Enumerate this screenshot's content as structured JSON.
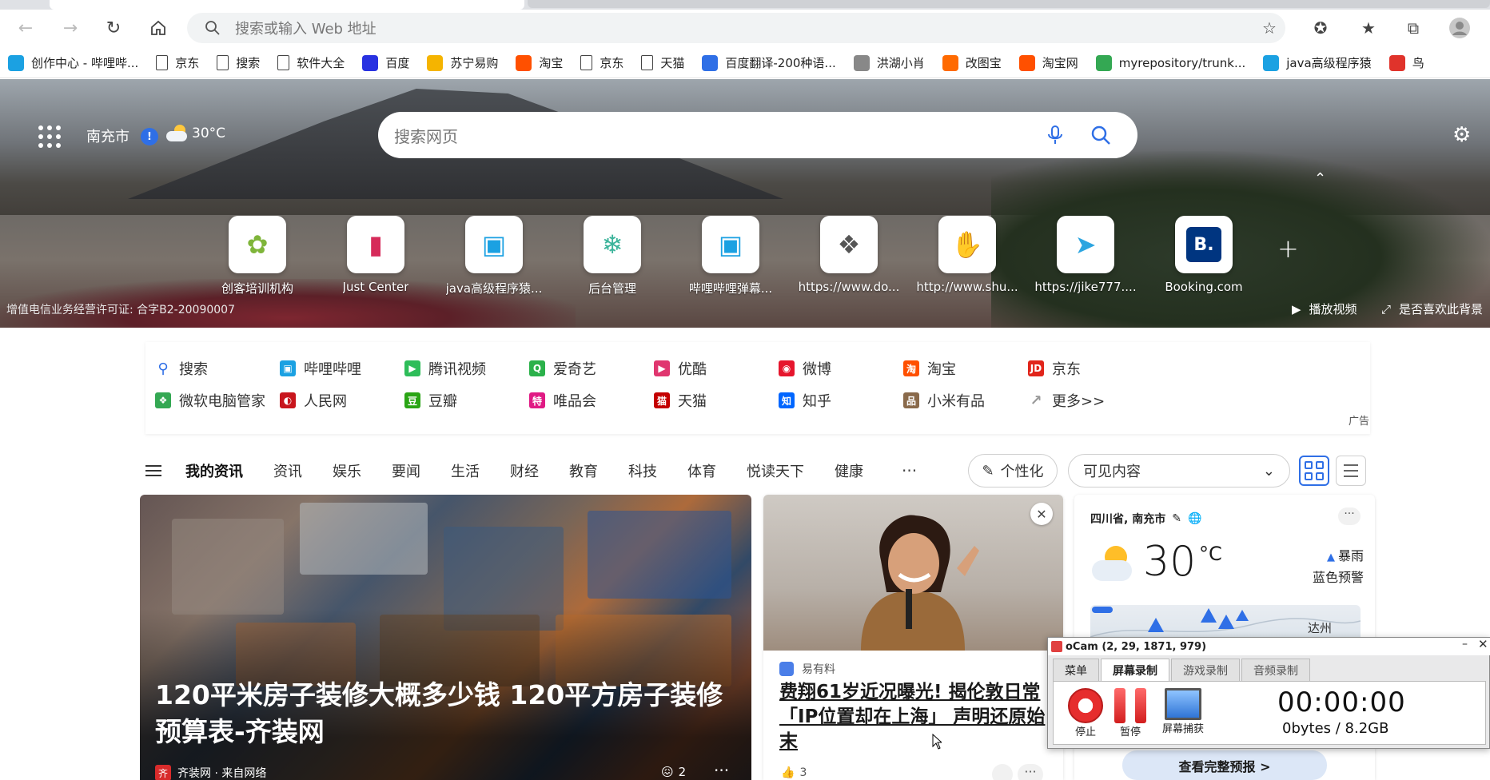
{
  "browser": {
    "address_placeholder": "搜索或输入 Web 地址",
    "bookmarks": [
      {
        "label": "创作中心 - 哔哩哔...",
        "color": "#1ba1e2",
        "icon": "bilibili-icon"
      },
      {
        "label": "京东",
        "color": "#ffffff",
        "icon": "page-icon"
      },
      {
        "label": "搜索",
        "color": "#ffffff",
        "icon": "page-icon"
      },
      {
        "label": "软件大全",
        "color": "#ffffff",
        "icon": "page-icon"
      },
      {
        "label": "百度",
        "color": "#2932e1",
        "icon": "baidu-icon"
      },
      {
        "label": "苏宁易购",
        "color": "#f5b400",
        "icon": "suning-icon"
      },
      {
        "label": "淘宝",
        "color": "#ff5000",
        "icon": "taobao-icon"
      },
      {
        "label": "京东",
        "color": "#ffffff",
        "icon": "page-icon"
      },
      {
        "label": "天猫",
        "color": "#ffffff",
        "icon": "page-icon"
      },
      {
        "label": "百度翻译-200种语...",
        "color": "#2f6fe6",
        "icon": "baidu-translate-icon"
      },
      {
        "label": "洪湖小肖",
        "color": "#888888",
        "icon": "eagle-icon"
      },
      {
        "label": "改图宝",
        "color": "#ff6a00",
        "icon": "gaitubao-icon"
      },
      {
        "label": "淘宝网",
        "color": "#ff5000",
        "icon": "taobao-icon"
      },
      {
        "label": "myrepository/trunk...",
        "color": "#34a853",
        "icon": "chrome-icon"
      },
      {
        "label": "java高级程序猿",
        "color": "#1ba1e2",
        "icon": "bilibili-icon"
      },
      {
        "label": "鸟",
        "color": "#e0332b",
        "icon": "bird-icon"
      }
    ]
  },
  "hero": {
    "city": "南充市",
    "warning": "!",
    "temp": "30°C",
    "search_placeholder": "搜索网页",
    "tiles": [
      {
        "label": "创客培训机构",
        "icon": "leaf-icon"
      },
      {
        "label": "Just Center",
        "icon": "phone-icon"
      },
      {
        "label": "java高级程序猿...",
        "icon": "bilibili-icon"
      },
      {
        "label": "后台管理",
        "icon": "plant-icon"
      },
      {
        "label": "哔哩哔哩弹幕...",
        "icon": "bilibili-icon"
      },
      {
        "label": "https://www.do...",
        "icon": "eagle-icon"
      },
      {
        "label": "http://www.shu...",
        "icon": "hand-icon"
      },
      {
        "label": "https://jike777....",
        "icon": "telegram-icon"
      },
      {
        "label": "Booking.com",
        "icon": "booking-icon"
      }
    ],
    "license": "增值电信业务经营许可证: 合字B2-20090007",
    "play_video": "播放视频",
    "like_bg": "是否喜欢此背景"
  },
  "links": {
    "row1": [
      {
        "label": "搜索",
        "color": "#2f6fe6",
        "icon": "search-icon"
      },
      {
        "label": "哔哩哔哩",
        "color": "#1ba1e2",
        "icon": "bilibili-icon"
      },
      {
        "label": "腾讯视频",
        "color": "#2ebd59",
        "icon": "tencent-video-icon"
      },
      {
        "label": "爱奇艺",
        "color": "#2bb14a",
        "icon": "iqiyi-icon"
      },
      {
        "label": "优酷",
        "color": "#e0366f",
        "icon": "youku-icon"
      },
      {
        "label": "微博",
        "color": "#e6162d",
        "icon": "weibo-icon"
      },
      {
        "label": "淘宝",
        "color": "#ff5000",
        "icon": "taobao-icon"
      },
      {
        "label": "京东",
        "color": "#e1251b",
        "icon": "jd-icon"
      }
    ],
    "row2": [
      {
        "label": "微软电脑管家",
        "color": "#34a853",
        "icon": "pc-manager-icon"
      },
      {
        "label": "人民网",
        "color": "#c8161d",
        "icon": "people-icon"
      },
      {
        "label": "豆瓣",
        "color": "#2aa515",
        "icon": "douban-icon"
      },
      {
        "label": "唯品会",
        "color": "#e01a84",
        "icon": "vip-icon"
      },
      {
        "label": "天猫",
        "color": "#c40000",
        "icon": "tmall-icon"
      },
      {
        "label": "知乎",
        "color": "#0066ff",
        "icon": "zhihu-icon"
      },
      {
        "label": "小米有品",
        "color": "#8a6a4b",
        "icon": "youpin-icon"
      },
      {
        "label": "更多>>",
        "color": "#999999",
        "icon": "more-icon"
      }
    ],
    "ad": "广告"
  },
  "feed": {
    "tabs": [
      "我的资讯",
      "资讯",
      "娱乐",
      "要闻",
      "生活",
      "财经",
      "教育",
      "科技",
      "体育",
      "悦读天下",
      "健康"
    ],
    "more": "···",
    "personalize": "个性化",
    "visible_content": "可见内容"
  },
  "cards": {
    "c1": {
      "title": "120平米房子装修大概多少钱 120平方房子装修预算表-齐装网",
      "source": "齐装网 · 来自网络",
      "logo": "齐",
      "reactions": "2",
      "more": "···"
    },
    "c2": {
      "source": "易有料",
      "title": "费翔61岁近况曝光! 揭伦敦日常「IP位置却在上海」 声明还原始末",
      "likes": "3",
      "more": "···"
    },
    "c3": {
      "location": "四川省, 南充市",
      "temp": "30",
      "unit": "°C",
      "alert_line1": "暴雨",
      "alert_line2": "蓝色预警",
      "map_label": "达州",
      "full_forecast": "查看完整预报 >",
      "more": "···"
    }
  },
  "ocam": {
    "title": "oCam (2, 29, 1871, 979)",
    "tabs": [
      "菜单",
      "屏幕录制",
      "游戏录制",
      "音频录制"
    ],
    "stop": "停止",
    "pause": "暂停",
    "capture": "屏幕捕获",
    "time": "00:00:00",
    "size": "0bytes / 8.2GB"
  }
}
